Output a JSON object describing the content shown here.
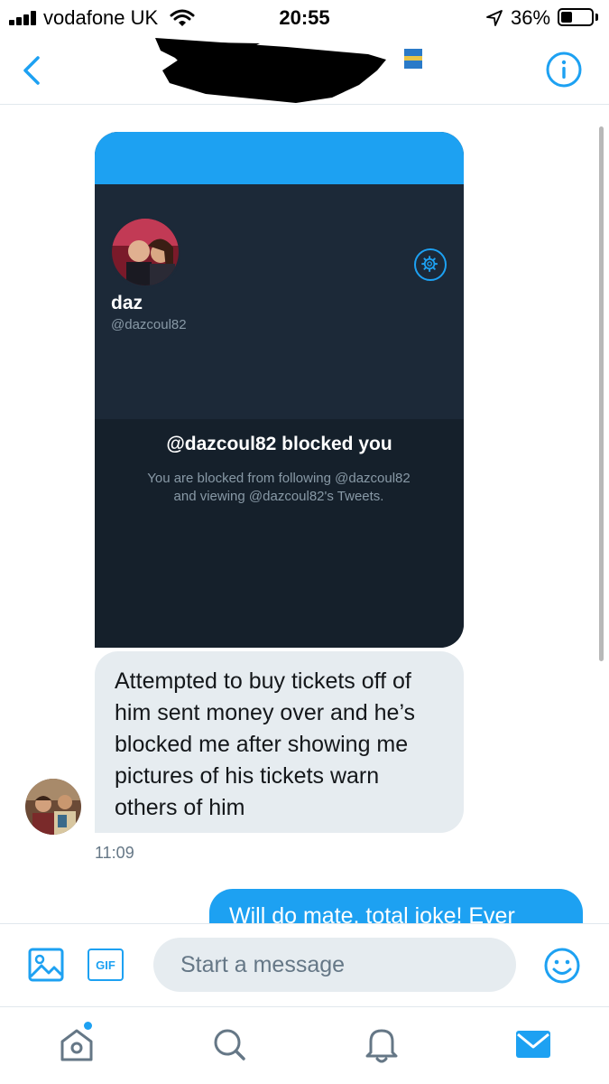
{
  "status_bar": {
    "carrier": "vodafone UK",
    "time": "20:55",
    "battery_percent": "36%",
    "battery_level": 0.36
  },
  "header": {
    "title": "[redacted]",
    "back_icon": "chevron-left-icon",
    "info_icon": "info-icon"
  },
  "shared_screenshot": {
    "profile_name": "daz",
    "profile_handle": "@dazcoul82",
    "blocked_title": "@dazcoul82 blocked you",
    "blocked_description": "You are blocked from following @dazcoul82 and viewing @dazcoul82's Tweets.",
    "settings_icon": "gear-icon"
  },
  "messages": [
    {
      "direction": "received",
      "text": "Attempted to buy tickets off of him sent money over and he’s blocked me after showing me pictures of his tickets warn others of him",
      "timestamp": "11:09"
    },
    {
      "direction": "sent",
      "text": "Will do mate, total joke! Ever"
    }
  ],
  "compose": {
    "placeholder": "Start a message",
    "gif_label": "GIF",
    "media_icon": "image-icon",
    "emoji_icon": "smiley-icon"
  },
  "tabs": [
    {
      "name": "home",
      "icon": "home-icon",
      "has_badge": true
    },
    {
      "name": "search",
      "icon": "search-icon"
    },
    {
      "name": "notifications",
      "icon": "bell-icon"
    },
    {
      "name": "messages",
      "icon": "envelope-icon",
      "active": true
    }
  ],
  "colors": {
    "accent": "#1da1f2",
    "bubble_received": "#e6ecf0",
    "dark_background": "#15202b",
    "dark_panel": "#1c2938",
    "muted_text": "#8899a6"
  }
}
